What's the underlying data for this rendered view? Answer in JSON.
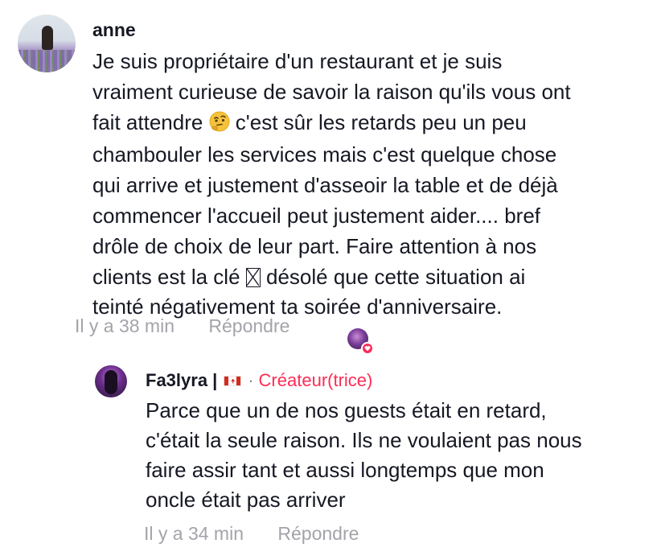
{
  "comment": {
    "username": "anne",
    "text_lines": [
      "Je suis propriétaire d'un restaurant et je suis",
      "vraiment curieuse de savoir la raison qu'ils vous ont",
      "fait attendre",
      "c'est sûr les retards peu un peu",
      "chambouler les services mais c'est quelque chose",
      "qui arrive et justement d'asseoir la table et de déjà",
      "commencer l'accueil peut justement aider.... bref",
      "drôle de choix de leur part. Faire attention à nos",
      "clients est la clé",
      "désolé que cette situation ai",
      "teinté négativement ta soirée d'anniversaire."
    ],
    "emoji_thinking": "thinking-face-emoji",
    "emoji_unrendered": "missing-glyph",
    "time": "Il y a 38 min",
    "reply_label": "Répondre",
    "liked_by_creator": "creator-liked-heart-icon"
  },
  "reply": {
    "username": "Fa3lyra",
    "separator": "|",
    "flag": "canada-flag-icon",
    "dot": "·",
    "badge": "Créateur(trice)",
    "text_lines": [
      "Parce que un de nos guests était en retard,",
      "c'était la seule raison. Ils ne voulaient pas nous",
      "faire assir tant et aussi longtemps que mon",
      "oncle était pas arriver"
    ],
    "time": "Il y a 34 min",
    "reply_label": "Répondre"
  },
  "colors": {
    "text": "#161823",
    "meta": "#a3a3aa",
    "creator_badge": "#fe2c55",
    "heart": "#fe2c55"
  }
}
